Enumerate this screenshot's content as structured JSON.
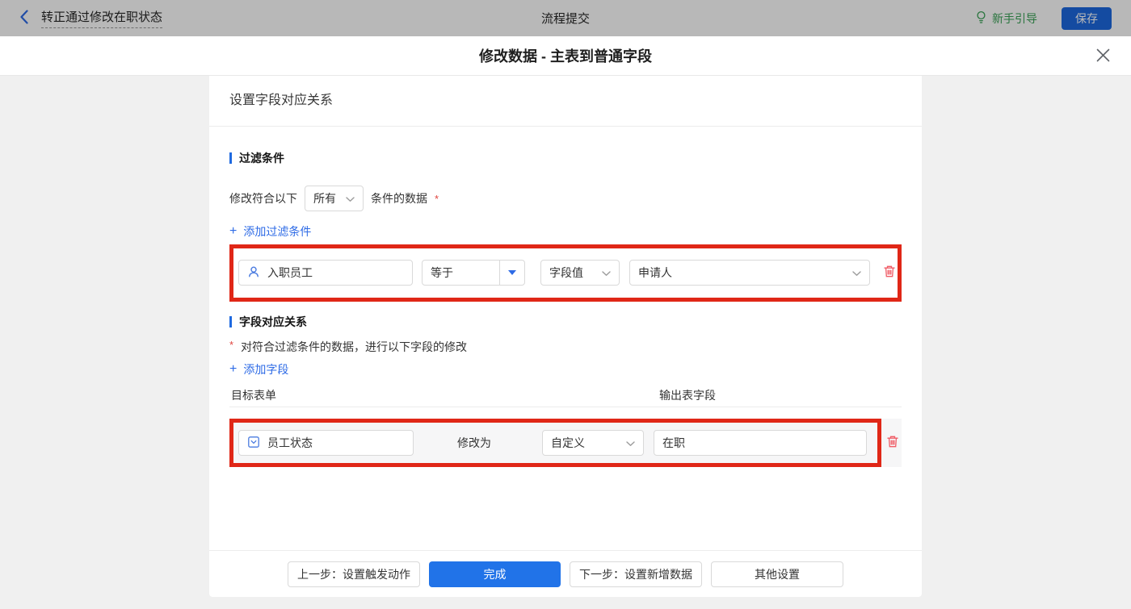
{
  "topbar": {
    "back_label": "转正通过修改在职状态",
    "center_title": "流程提交",
    "guide_label": "新手引导",
    "save_label": "保存"
  },
  "modal": {
    "title": "修改数据 - 主表到普通字段"
  },
  "panel": {
    "header": "设置字段对应关系",
    "filter": {
      "title": "过滤条件",
      "prefix": "修改符合以下",
      "match_value": "所有",
      "suffix": "条件的数据",
      "add_label": "添加过滤条件",
      "row": {
        "field": "入职员工",
        "operator": "等于",
        "value_type": "字段值",
        "value": "申请人"
      }
    },
    "mapping": {
      "title": "字段对应关系",
      "description": "对符合过滤条件的数据，进行以下字段的修改",
      "add_label": "添加字段",
      "columns": [
        "目标表单",
        "输出表字段"
      ],
      "row": {
        "target": "员工状态",
        "action_label": "修改为",
        "mode": "自定义",
        "value": "在职"
      }
    }
  },
  "footer": {
    "prev_label": "上一步：设置触发动作",
    "done_label": "完成",
    "next_label": "下一步：设置新增数据",
    "other_label": "其他设置"
  },
  "ui": {
    "plus": "+",
    "required": "*"
  },
  "colors": {
    "accent_blue": "#2e6be6",
    "primary_button_blue": "#2173e8",
    "section_bar_blue": "#1f6ae0",
    "annotation_red": "#e02717",
    "delete_red": "#f05c66",
    "guide_green": "#3aa256",
    "page_background": "#f0f0f0"
  },
  "icons": {
    "back": "chevron-left",
    "guide": "lightbulb",
    "close": "x",
    "filter_field": "user",
    "target_field": "select-box",
    "dropdown": "chevron-down",
    "operator_caret": "triangle-down",
    "delete": "trash",
    "add": "plus"
  }
}
